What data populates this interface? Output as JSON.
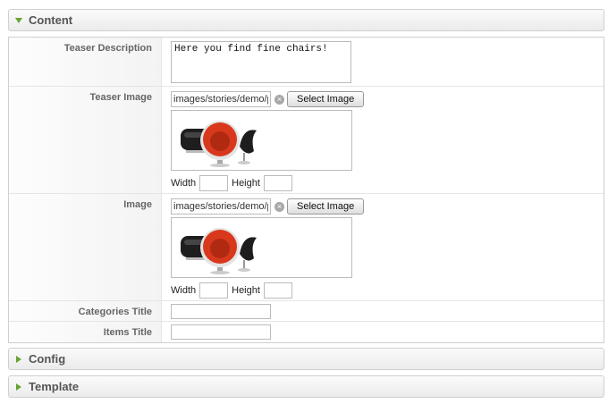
{
  "sections": {
    "content": {
      "title": "Content",
      "expanded": true
    },
    "config": {
      "title": "Config",
      "expanded": false
    },
    "template": {
      "title": "Template",
      "expanded": false
    }
  },
  "fields": {
    "teaser_description": {
      "label": "Teaser Description",
      "value": "Here you find fine chairs!"
    },
    "teaser_image": {
      "label": "Teaser Image",
      "path": "images/stories/demo/products/chairs.jpg",
      "button": "Select Image",
      "width_label": "Width",
      "height_label": "Height",
      "width": "",
      "height": ""
    },
    "image": {
      "label": "Image",
      "path": "images/stories/demo/products/chairs.jpg",
      "button": "Select Image",
      "width_label": "Width",
      "height_label": "Height",
      "width": "",
      "height": ""
    },
    "categories_title": {
      "label": "Categories Title",
      "value": ""
    },
    "items_title": {
      "label": "Items Title",
      "value": ""
    }
  },
  "colors": {
    "accent": "#67a334",
    "chair_red": "#d8391d",
    "chair_black": "#1e1e1e"
  },
  "icons": [
    "triangle-down-icon",
    "triangle-right-icon",
    "clear-icon"
  ]
}
